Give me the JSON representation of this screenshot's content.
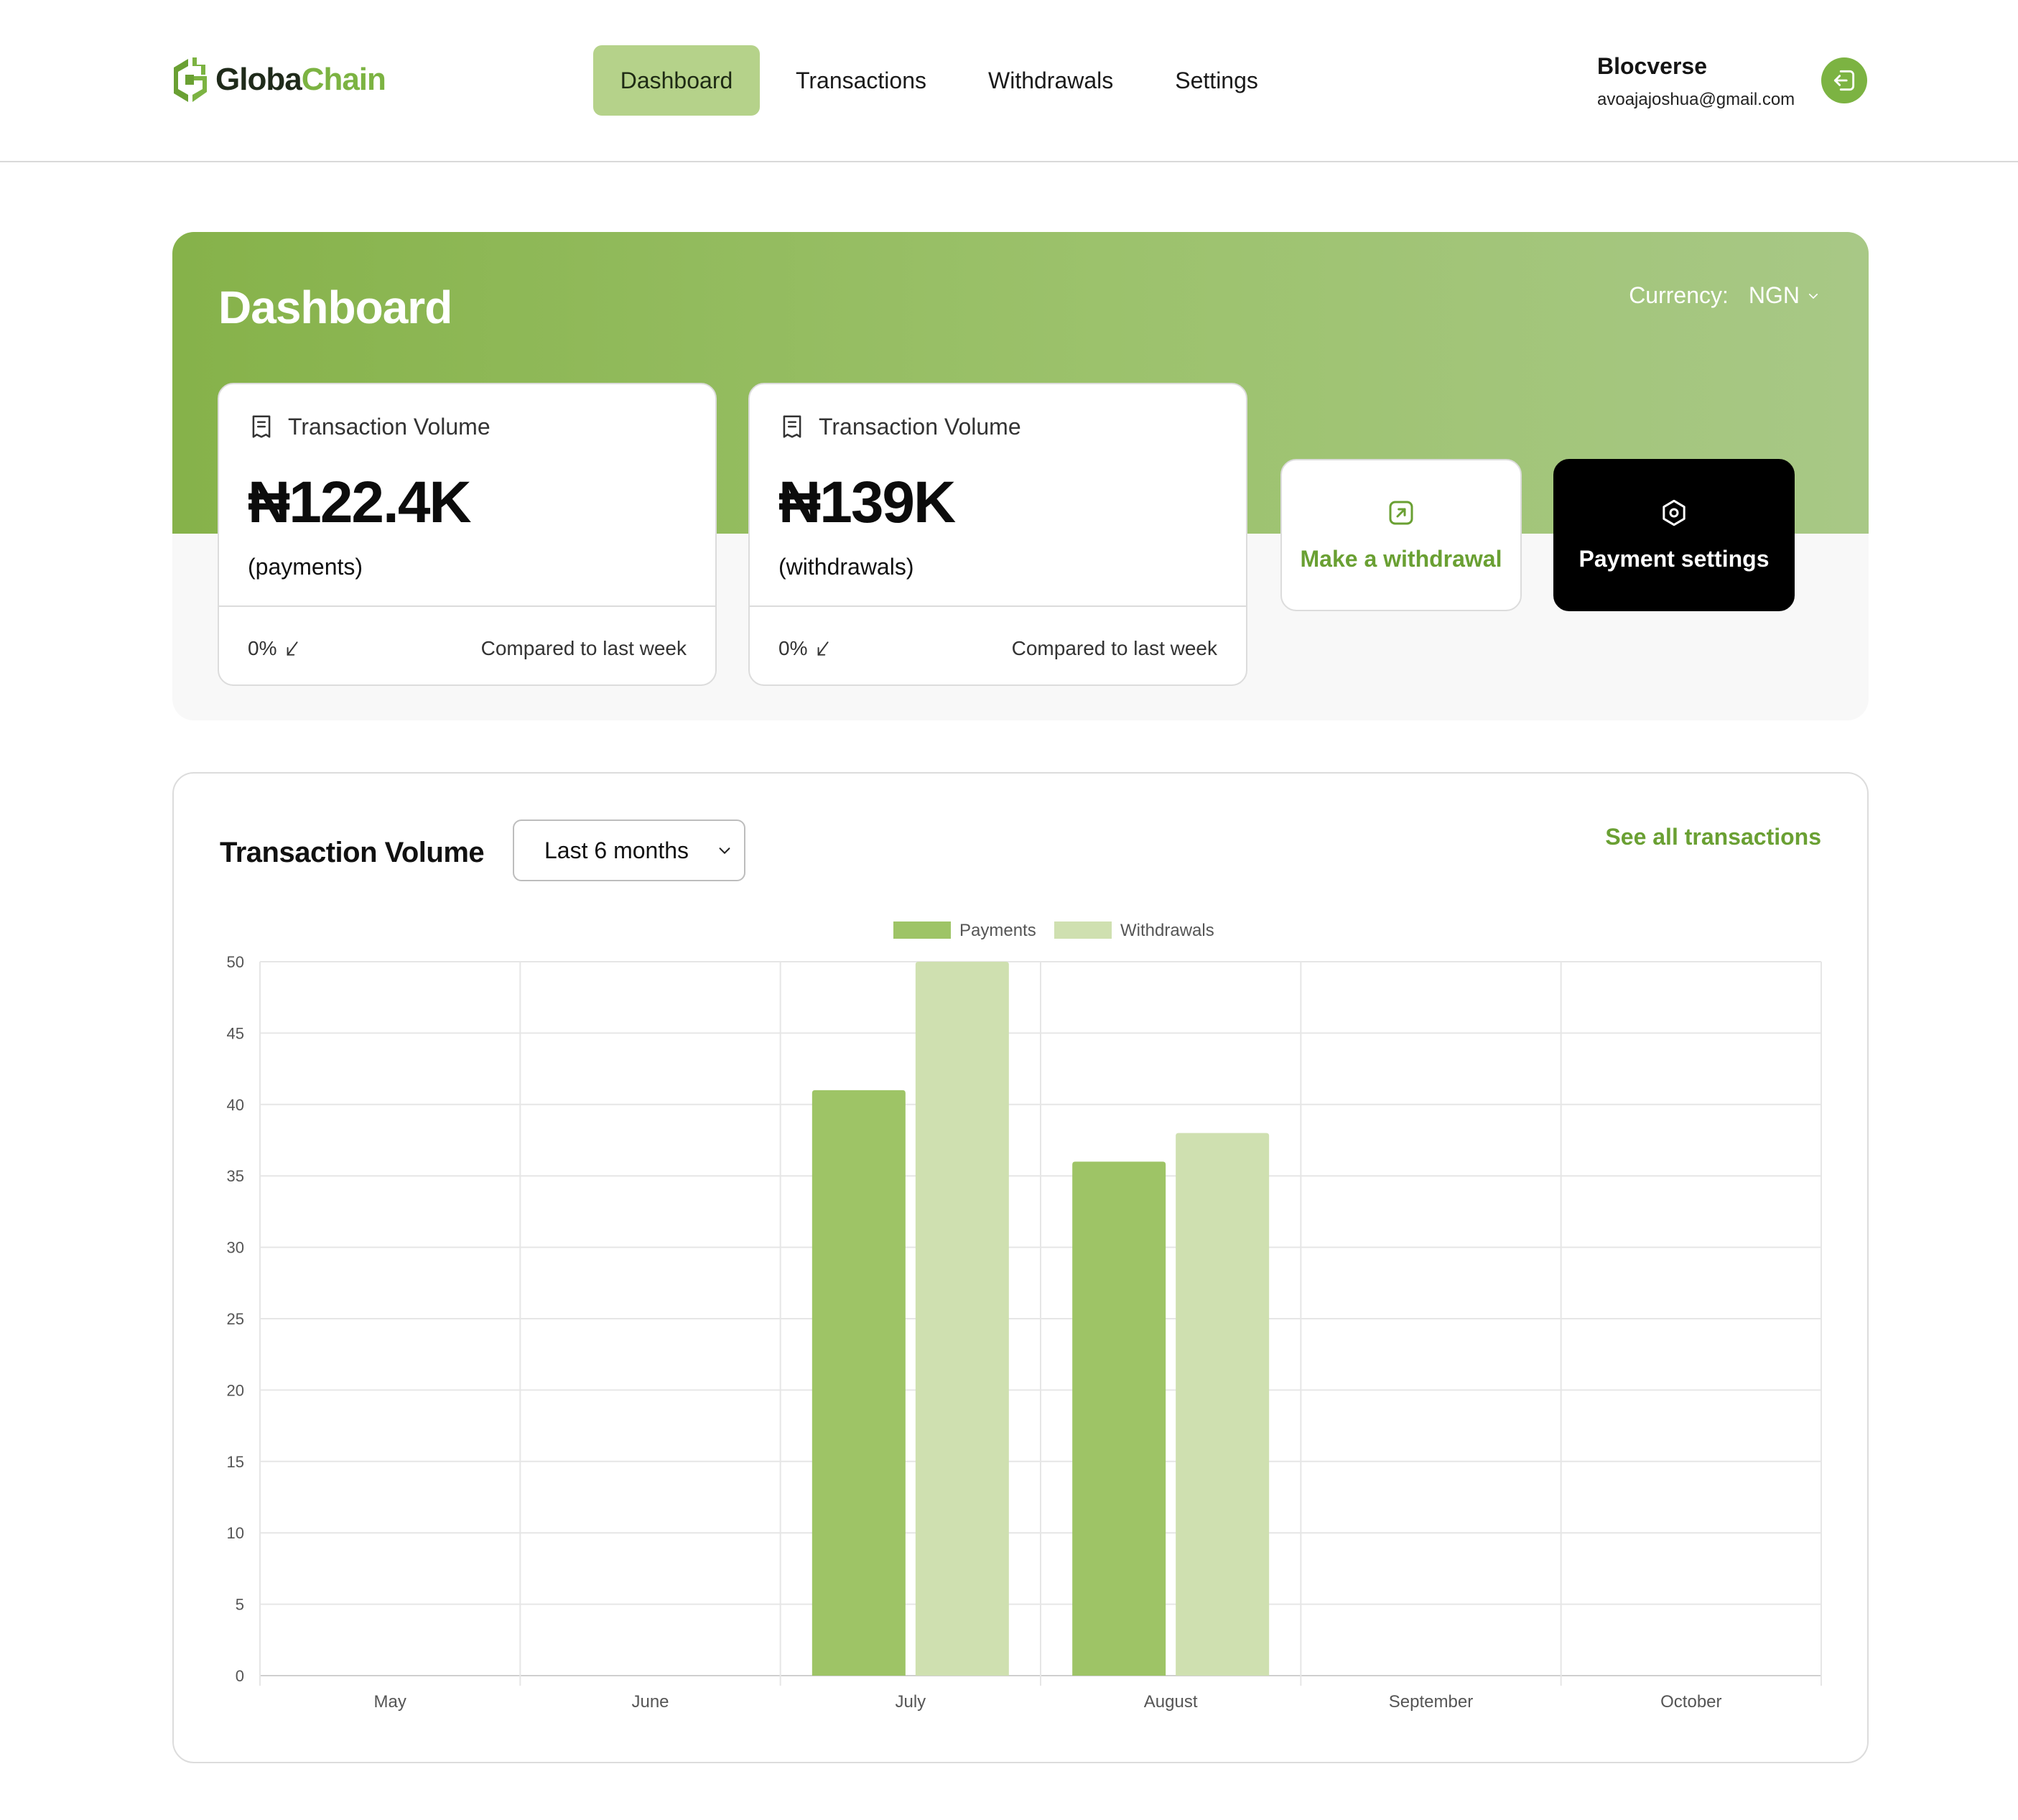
{
  "brand": {
    "name_part1": "Globa",
    "name_part2": "Chain",
    "accent": "#7cb342"
  },
  "nav": {
    "items": [
      {
        "label": "Dashboard",
        "active": true
      },
      {
        "label": "Transactions",
        "active": false
      },
      {
        "label": "Withdrawals",
        "active": false
      },
      {
        "label": "Settings",
        "active": false
      }
    ]
  },
  "user": {
    "name": "Blocverse",
    "email": "avoajajoshua@gmail.com",
    "logout_icon": "logout-icon"
  },
  "hero": {
    "title": "Dashboard",
    "currency_label": "Currency:",
    "currency_value": "NGN",
    "cards": [
      {
        "title": "Transaction Volume",
        "value": "₦122.4K",
        "sub": "(payments)",
        "change": "0%",
        "compare": "Compared to last week",
        "icon": "receipt-icon"
      },
      {
        "title": "Transaction Volume",
        "value": "₦139K",
        "sub": "(withdrawals)",
        "change": "0%",
        "compare": "Compared to last week",
        "icon": "receipt-icon"
      }
    ],
    "actions": {
      "withdraw_label": "Make a withdrawal",
      "settings_label": "Payment settings"
    }
  },
  "chart_section": {
    "title": "Transaction Volume",
    "period": "Last 6 months",
    "see_all": "See all transactions"
  },
  "chart_data": {
    "type": "bar",
    "categories": [
      "May",
      "June",
      "July",
      "August",
      "September",
      "October"
    ],
    "series": [
      {
        "name": "Payments",
        "color": "#9ec466",
        "values": [
          0,
          0,
          41,
          36,
          0,
          0
        ]
      },
      {
        "name": "Withdrawals",
        "color": "#cfe0b0",
        "values": [
          0,
          0,
          50,
          38,
          0,
          0
        ]
      }
    ],
    "ylim": [
      0,
      50
    ],
    "yticks": [
      0,
      5,
      10,
      15,
      20,
      25,
      30,
      35,
      40,
      45,
      50
    ],
    "grid": true,
    "legend": "top-center"
  }
}
